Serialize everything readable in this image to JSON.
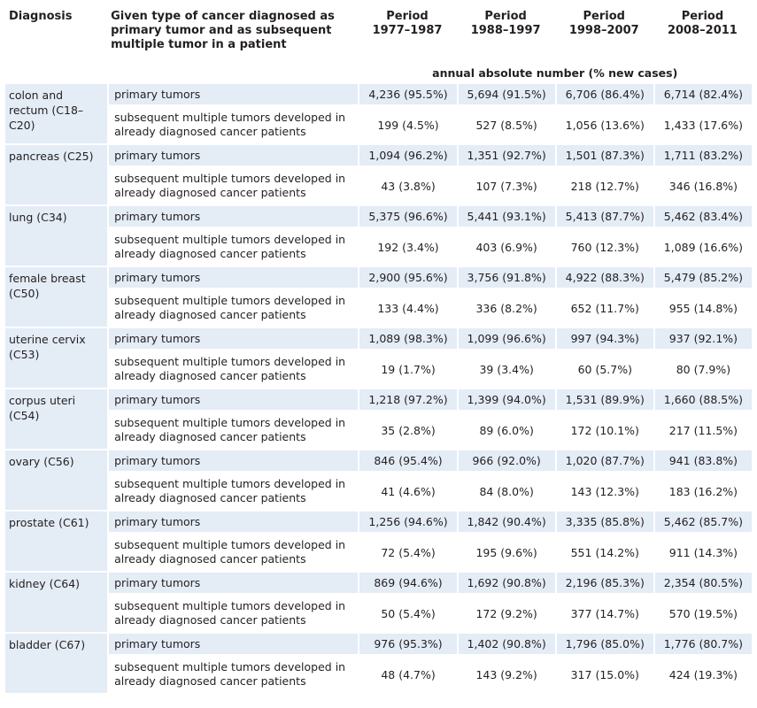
{
  "header": {
    "diagnosis": "Diagnosis",
    "type": "Given type of cancer diagnosed as primary tumor and as subsequent multiple tumor in a patient",
    "periods": [
      {
        "label": "Period",
        "years": "1977–1987"
      },
      {
        "label": "Period",
        "years": "1988–1997"
      },
      {
        "label": "Period",
        "years": "1998–2007"
      },
      {
        "label": "Period",
        "years": "2008–2011"
      }
    ],
    "unit": "annual absolute number (% new cases)"
  },
  "row_labels": {
    "primary": "primary tumors",
    "secondary": "subsequent multiple tumors developed in already diagnosed cancer patients"
  },
  "rows": [
    {
      "diagnosis": "colon and rectum (C18–C20)",
      "primary": [
        "4,236 (95.5%)",
        "5,694 (91.5%)",
        "6,706 (86.4%)",
        "6,714 (82.4%)"
      ],
      "secondary": [
        "199 (4.5%)",
        "527 (8.5%)",
        "1,056 (13.6%)",
        "1,433 (17.6%)"
      ]
    },
    {
      "diagnosis": "pancreas (C25)",
      "primary": [
        "1,094 (96.2%)",
        "1,351 (92.7%)",
        "1,501 (87.3%)",
        "1,711 (83.2%)"
      ],
      "secondary": [
        "43 (3.8%)",
        "107 (7.3%)",
        "218 (12.7%)",
        "346 (16.8%)"
      ]
    },
    {
      "diagnosis": "lung (C34)",
      "primary": [
        "5,375 (96.6%)",
        "5,441 (93.1%)",
        "5,413 (87.7%)",
        "5,462 (83.4%)"
      ],
      "secondary": [
        "192 (3.4%)",
        "403 (6.9%)",
        "760 (12.3%)",
        "1,089 (16.6%)"
      ]
    },
    {
      "diagnosis": "female breast (C50)",
      "primary": [
        "2,900 (95.6%)",
        "3,756 (91.8%)",
        "4,922 (88.3%)",
        "5,479 (85.2%)"
      ],
      "secondary": [
        "133 (4.4%)",
        "336 (8.2%)",
        "652 (11.7%)",
        "955 (14.8%)"
      ]
    },
    {
      "diagnosis": "uterine cervix (C53)",
      "primary": [
        "1,089 (98.3%)",
        "1,099 (96.6%)",
        "997 (94.3%)",
        "937 (92.1%)"
      ],
      "secondary": [
        "19 (1.7%)",
        "39 (3.4%)",
        "60 (5.7%)",
        "80 (7.9%)"
      ]
    },
    {
      "diagnosis": "corpus uteri (C54)",
      "primary": [
        "1,218 (97.2%)",
        "1,399 (94.0%)",
        "1,531 (89.9%)",
        "1,660 (88.5%)"
      ],
      "secondary": [
        "35 (2.8%)",
        "89 (6.0%)",
        "172 (10.1%)",
        "217 (11.5%)"
      ]
    },
    {
      "diagnosis": "ovary (C56)",
      "primary": [
        "846 (95.4%)",
        "966 (92.0%)",
        "1,020 (87.7%)",
        "941 (83.8%)"
      ],
      "secondary": [
        "41 (4.6%)",
        "84 (8.0%)",
        "143 (12.3%)",
        "183 (16.2%)"
      ]
    },
    {
      "diagnosis": "prostate (C61)",
      "primary": [
        "1,256 (94.6%)",
        "1,842 (90.4%)",
        "3,335 (85.8%)",
        "5,462 (85.7%)"
      ],
      "secondary": [
        "72 (5.4%)",
        "195 (9.6%)",
        "551 (14.2%)",
        "911 (14.3%)"
      ]
    },
    {
      "diagnosis": "kidney (C64)",
      "primary": [
        "869 (94.6%)",
        "1,692 (90.8%)",
        "2,196 (85.3%)",
        "2,354 (80.5%)"
      ],
      "secondary": [
        "50 (5.4%)",
        "172 (9.2%)",
        "377 (14.7%)",
        "570 (19.5%)"
      ]
    },
    {
      "diagnosis": "bladder (C67)",
      "primary": [
        "976 (95.3%)",
        "1,402 (90.8%)",
        "1,796 (85.0%)",
        "1,776 (80.7%)"
      ],
      "secondary": [
        "48 (4.7%)",
        "143 (9.2%)",
        "317 (15.0%)",
        "424 (19.3%)"
      ]
    }
  ],
  "colors": {
    "row_shade": "#e4ecf6",
    "text": "#231f20"
  }
}
